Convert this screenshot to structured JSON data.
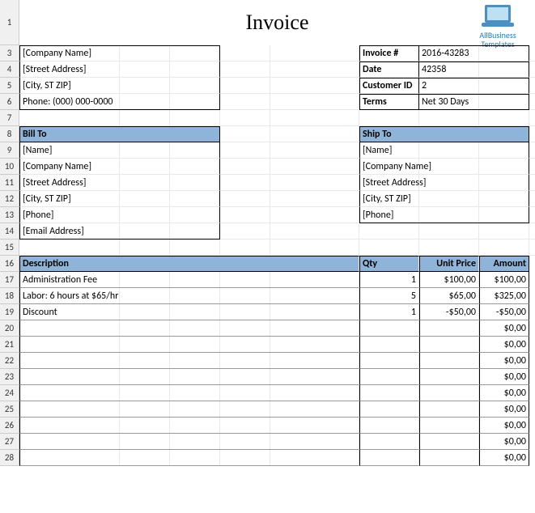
{
  "title": "Invoice",
  "logo_text": "AllBusiness Templates",
  "company": {
    "name": "[Company Name]",
    "street": "[Street Address]",
    "city": "[City, ST ZIP]",
    "phone": "Phone: (000) 000-0000"
  },
  "invoice_meta": {
    "labels": {
      "no": "Invoice #",
      "date": "Date",
      "cust": "Customer ID",
      "terms": "Terms"
    },
    "values": {
      "no": "2016-43283",
      "date": "42358",
      "cust": "2",
      "terms": "Net 30 Days"
    }
  },
  "bill_to": {
    "header": "Bill To",
    "name": "[Name]",
    "company": "[Company Name]",
    "street": "[Street Address]",
    "city": "[City, ST ZIP]",
    "phone": "[Phone]",
    "email": "[Email Address]"
  },
  "ship_to": {
    "header": "Ship To",
    "name": "[Name]",
    "company": "[Company Name]",
    "street": "[Street Address]",
    "city": "[City, ST ZIP]",
    "phone": "[Phone]"
  },
  "table": {
    "headers": {
      "desc": "Description",
      "qty": "Qty",
      "unit": "Unit Price",
      "amount": "Amount"
    },
    "rows": [
      {
        "desc": "Administration Fee",
        "qty": "1",
        "unit": "$100,00",
        "amount": "$100,00"
      },
      {
        "desc": "Labor: 6 hours at $65/hr",
        "qty": "5",
        "unit": "$65,00",
        "amount": "$325,00"
      },
      {
        "desc": "Discount",
        "qty": "1",
        "unit": "-$50,00",
        "amount": "-$50,00"
      },
      {
        "desc": "",
        "qty": "",
        "unit": "",
        "amount": "$0,00"
      },
      {
        "desc": "",
        "qty": "",
        "unit": "",
        "amount": "$0,00"
      },
      {
        "desc": "",
        "qty": "",
        "unit": "",
        "amount": "$0,00"
      },
      {
        "desc": "",
        "qty": "",
        "unit": "",
        "amount": "$0,00"
      },
      {
        "desc": "",
        "qty": "",
        "unit": "",
        "amount": "$0,00"
      },
      {
        "desc": "",
        "qty": "",
        "unit": "",
        "amount": "$0,00"
      },
      {
        "desc": "",
        "qty": "",
        "unit": "",
        "amount": "$0,00"
      },
      {
        "desc": "",
        "qty": "",
        "unit": "",
        "amount": "$0,00"
      },
      {
        "desc": "",
        "qty": "",
        "unit": "",
        "amount": "$0,00"
      }
    ]
  },
  "row_numbers": [
    "1",
    "3",
    "4",
    "5",
    "6",
    "7",
    "8",
    "9",
    "10",
    "11",
    "12",
    "13",
    "14",
    "15",
    "16",
    "17",
    "18",
    "19",
    "20",
    "21",
    "22",
    "23",
    "24",
    "25",
    "26",
    "27",
    "28"
  ]
}
